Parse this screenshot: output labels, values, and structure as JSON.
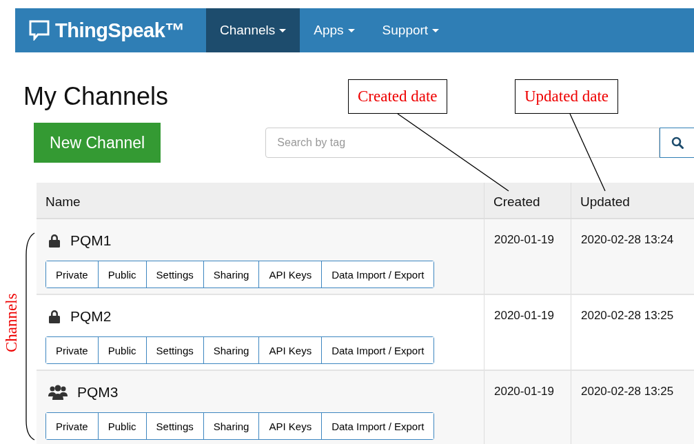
{
  "navbar": {
    "brand": "ThingSpeak™",
    "menus": [
      {
        "label": "Channels",
        "selected": true
      },
      {
        "label": "Apps",
        "selected": false
      },
      {
        "label": "Support",
        "selected": false
      }
    ]
  },
  "page_title": "My Channels",
  "new_channel_button": "New Channel",
  "search": {
    "placeholder": "Search by tag"
  },
  "table": {
    "columns": [
      "Name",
      "Created",
      "Updated"
    ],
    "rows": [
      {
        "name": "PQM1",
        "kind": "private",
        "actions": [
          "Private",
          "Public",
          "Settings",
          "Sharing",
          "API Keys",
          "Data Import / Export"
        ],
        "created": "2020-01-19",
        "updated": "2020-02-28 13:24"
      },
      {
        "name": "PQM2",
        "kind": "private",
        "actions": [
          "Private",
          "Public",
          "Settings",
          "Sharing",
          "API Keys",
          "Data Import / Export"
        ],
        "created": "2020-01-19",
        "updated": "2020-02-28 13:25"
      },
      {
        "name": "PQM3",
        "kind": "public",
        "actions": [
          "Private",
          "Public",
          "Settings",
          "Sharing",
          "API Keys",
          "Data Import / Export"
        ],
        "created": "2020-01-19",
        "updated": "2020-02-28 13:25"
      }
    ]
  },
  "annotations": {
    "callouts": [
      "Created date",
      "Updated date"
    ],
    "bracket_label": "Channels"
  }
}
